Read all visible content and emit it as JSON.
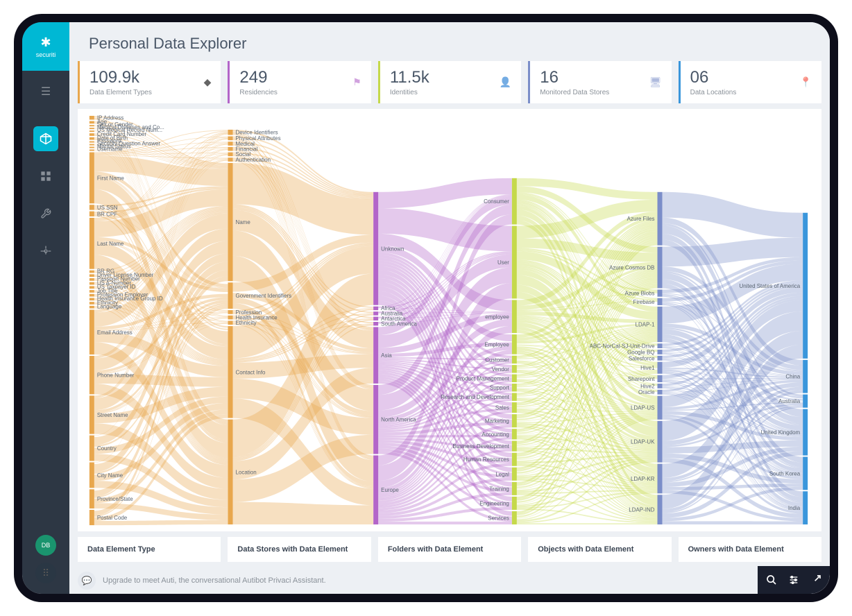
{
  "app": {
    "logo_text": "securiti"
  },
  "page": {
    "title": "Personal Data Explorer"
  },
  "stats": [
    {
      "value": "109.9k",
      "label": "Data Element Types",
      "icon": "◆",
      "color": "#e8a74d"
    },
    {
      "value": "249",
      "label": "Residencies",
      "icon": "⚑",
      "color": "#b365c9"
    },
    {
      "value": "11.5k",
      "label": "Identities",
      "icon": "👤",
      "color": "#c5d94a"
    },
    {
      "value": "16",
      "label": "Monitored Data Stores",
      "icon": "🖥",
      "color": "#7b8ec9"
    },
    {
      "value": "06",
      "label": "Data Locations",
      "icon": "📍",
      "color": "#3a96db"
    }
  ],
  "column_headers": [
    "Data Element Type",
    "Data Stores with Data Element",
    "Folders with Data Element",
    "Objects with Data Element",
    "Owners with Data Element"
  ],
  "footer": {
    "message": "Upgrade to meet Auti, the conversational Autibot Privaci Assistant."
  },
  "user": {
    "initials": "DB"
  },
  "chart_data": {
    "type": "sankey",
    "columns": [
      {
        "name": "Data Element Type",
        "color": "#e8a74d",
        "nodes": [
          {
            "label": "IP Address",
            "size": 3
          },
          {
            "label": "Age",
            "size": 2
          },
          {
            "label": "Sex or Gender",
            "size": 1
          },
          {
            "label": "Medical Diseases and Co...",
            "size": 1
          },
          {
            "label": "US Medical Record Num...",
            "size": 1
          },
          {
            "label": "Credit Card Number",
            "size": 2
          },
          {
            "label": "Date of Birth",
            "size": 2
          },
          {
            "label": "Password",
            "size": 1
          },
          {
            "label": "Security Question Answer",
            "size": 1
          },
          {
            "label": "Marital Status",
            "size": 1
          },
          {
            "label": "Username",
            "size": 1
          },
          {
            "label": "First Name",
            "size": 40
          },
          {
            "label": "US SSN",
            "size": 4
          },
          {
            "label": "BR CPF",
            "size": 4
          },
          {
            "label": "Last Name",
            "size": 40
          },
          {
            "label": "BR RG",
            "size": 2
          },
          {
            "label": "Driver License Number",
            "size": 2
          },
          {
            "label": "Passport Number",
            "size": 2
          },
          {
            "label": "US A-Number",
            "size": 2
          },
          {
            "label": "US Taxpayer ID",
            "size": 2
          },
          {
            "label": "Job Title",
            "size": 2
          },
          {
            "label": "Profession Employer",
            "size": 2
          },
          {
            "label": "Health Insurance Group ID",
            "size": 2
          },
          {
            "label": "Ethnicity",
            "size": 2
          },
          {
            "label": "Language",
            "size": 2
          },
          {
            "label": "Email Address",
            "size": 35
          },
          {
            "label": "Phone Number",
            "size": 30
          },
          {
            "label": "Street Name",
            "size": 30
          },
          {
            "label": "Country",
            "size": 20
          },
          {
            "label": "City Name",
            "size": 20
          },
          {
            "label": "Province/State",
            "size": 15
          },
          {
            "label": "Postal Code",
            "size": 12
          }
        ]
      },
      {
        "name": "Data Stores with Data Element",
        "color": "#e8a74d",
        "nodes": [
          {
            "label": "Device Identifiers",
            "size": 4
          },
          {
            "label": "Physical Attributes",
            "size": 3
          },
          {
            "label": "Medical",
            "size": 3
          },
          {
            "label": "Financial",
            "size": 3
          },
          {
            "label": "Social",
            "size": 3
          },
          {
            "label": "Authentication",
            "size": 3
          },
          {
            "label": "Name",
            "size": 90
          },
          {
            "label": "Government Identifiers",
            "size": 20
          },
          {
            "label": "Profession",
            "size": 3
          },
          {
            "label": "Health Insurance",
            "size": 3
          },
          {
            "label": "Ethnicity",
            "size": 3
          },
          {
            "label": "Contact Info",
            "size": 70
          },
          {
            "label": "Location",
            "size": 80
          }
        ]
      },
      {
        "name": "Residencies",
        "color": "#b365c9",
        "nodes": [
          {
            "label": "Unknown",
            "size": 90
          },
          {
            "label": "Africa",
            "size": 3
          },
          {
            "label": "Australia",
            "size": 3
          },
          {
            "label": "Antarctica",
            "size": 3
          },
          {
            "label": "South America",
            "size": 3
          },
          {
            "label": "Asia",
            "size": 45
          },
          {
            "label": "North America",
            "size": 55
          },
          {
            "label": "Europe",
            "size": 55
          }
        ]
      },
      {
        "name": "Identities",
        "color": "#c5d94a",
        "nodes": [
          {
            "label": "Consumer",
            "size": 35
          },
          {
            "label": "User",
            "size": 55
          },
          {
            "label": "employee",
            "size": 25
          },
          {
            "label": "Employee",
            "size": 15
          },
          {
            "label": "Customer",
            "size": 6
          },
          {
            "label": "Vendor",
            "size": 6
          },
          {
            "label": "Product Management",
            "size": 6
          },
          {
            "label": "Support",
            "size": 6
          },
          {
            "label": "Research and Development",
            "size": 6
          },
          {
            "label": "Sales",
            "size": 8
          },
          {
            "label": "Marketing",
            "size": 10
          },
          {
            "label": "Accounting",
            "size": 8
          },
          {
            "label": "Business Development",
            "size": 8
          },
          {
            "label": "Human Resources",
            "size": 10
          },
          {
            "label": "Legal",
            "size": 10
          },
          {
            "label": "Training",
            "size": 10
          },
          {
            "label": "Engineering",
            "size": 10
          },
          {
            "label": "Services",
            "size": 10
          }
        ]
      },
      {
        "name": "Monitored Data Stores",
        "color": "#7b8ec9",
        "nodes": [
          {
            "label": "Azure Files",
            "size": 45
          },
          {
            "label": "Azure Cosmos DB",
            "size": 35
          },
          {
            "label": "Azure Blobs",
            "size": 6
          },
          {
            "label": "Firebase",
            "size": 6
          },
          {
            "label": "LDAP-1",
            "size": 30
          },
          {
            "label": "ABC-NorCal-SJ-Unit-Drive",
            "size": 4
          },
          {
            "label": "Google BQ",
            "size": 4
          },
          {
            "label": "Salesforce",
            "size": 4
          },
          {
            "label": "Hive1",
            "size": 10
          },
          {
            "label": "Sharepoint",
            "size": 6
          },
          {
            "label": "Hive2",
            "size": 4
          },
          {
            "label": "Oracle",
            "size": 4
          },
          {
            "label": "LDAP-US",
            "size": 20
          },
          {
            "label": "LDAP-UK",
            "size": 35
          },
          {
            "label": "LDAP-KR",
            "size": 25
          },
          {
            "label": "LDAP-IND",
            "size": 25
          }
        ]
      },
      {
        "name": "Data Locations",
        "color": "#3a96db",
        "nodes": [
          {
            "label": "United States of America",
            "size": 110
          },
          {
            "label": "China",
            "size": 25
          },
          {
            "label": "Australia",
            "size": 10
          },
          {
            "label": "United Kingdom",
            "size": 35
          },
          {
            "label": "South Korea",
            "size": 25
          },
          {
            "label": "India",
            "size": 25
          }
        ]
      }
    ]
  }
}
